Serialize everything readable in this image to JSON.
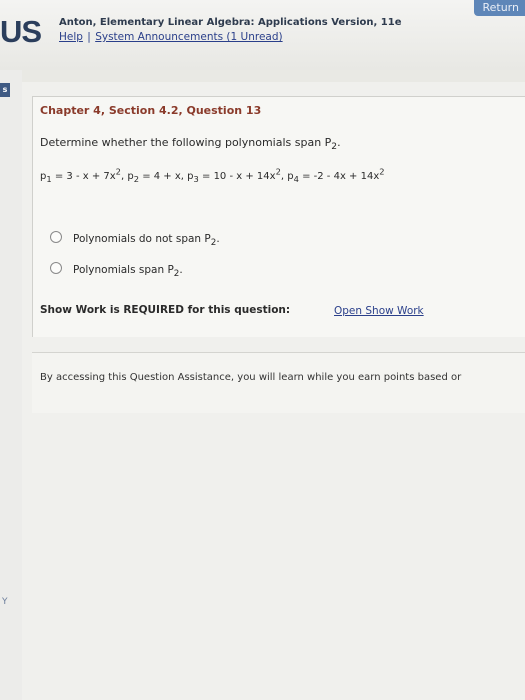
{
  "header": {
    "return_label": "Return",
    "brand": "US",
    "course_title": "Anton, Elementary Linear Algebra: Applications Version, 11e",
    "help_link": "Help",
    "separator": "|",
    "announcements_link": "System Announcements (1 Unread)"
  },
  "sidebar": {
    "tab_label": "s",
    "bottom_mark": "Y"
  },
  "question": {
    "heading": "Chapter 4, Section 4.2, Question 13",
    "prompt": "Determine whether the following polynomials span P",
    "prompt_sub": "2",
    "prompt_end": ".",
    "polynomials": [
      {
        "name": "p",
        "index": "1",
        "expr_a": " = 3 - x + 7x",
        "exp": "2",
        "expr_b": ","
      },
      {
        "name": "p",
        "index": "2",
        "expr_a": " = 4 + x,",
        "exp": "",
        "expr_b": ""
      },
      {
        "name": "p",
        "index": "3",
        "expr_a": " = 10 - x + 14x",
        "exp": "2",
        "expr_b": ","
      },
      {
        "name": "p",
        "index": "4",
        "expr_a": " = -2 - 4x + 14x",
        "exp": "2",
        "expr_b": ""
      }
    ],
    "options": [
      {
        "label": "Polynomials do not span P",
        "sub": "2",
        "end": "."
      },
      {
        "label": "Polynomials span P",
        "sub": "2",
        "end": "."
      }
    ],
    "show_work_text": "Show Work is REQUIRED for this question:",
    "show_work_link": "Open Show Work"
  },
  "assistance": {
    "text": "By accessing this Question Assistance, you will learn while you earn points based or"
  }
}
